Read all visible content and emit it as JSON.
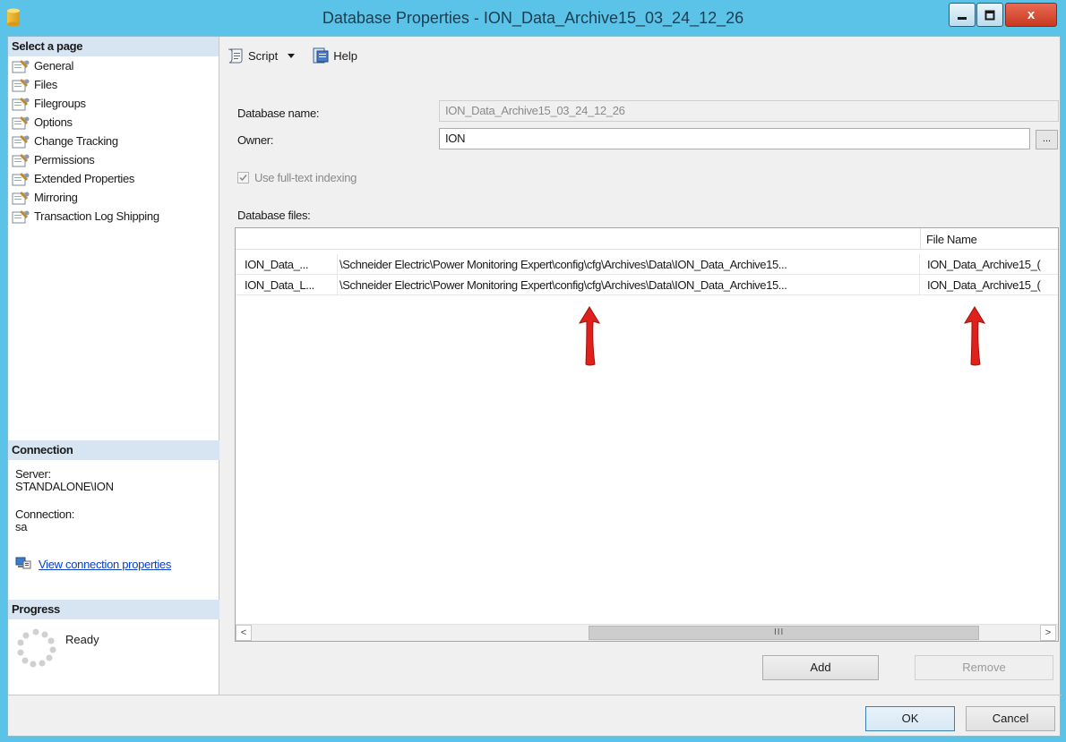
{
  "window": {
    "title": "Database Properties - ION_Data_Archive15_03_24_12_26",
    "close_glyph": "x"
  },
  "left_pane": {
    "select_page_header": "Select a page",
    "pages": [
      {
        "label": "General"
      },
      {
        "label": "Files"
      },
      {
        "label": "Filegroups"
      },
      {
        "label": "Options"
      },
      {
        "label": "Change Tracking"
      },
      {
        "label": "Permissions"
      },
      {
        "label": "Extended Properties"
      },
      {
        "label": "Mirroring"
      },
      {
        "label": "Transaction Log Shipping"
      }
    ],
    "connection_header": "Connection",
    "server_label": "Server:",
    "server_value": "STANDALONE\\ION",
    "connection_label": "Connection:",
    "connection_value": "sa",
    "view_connection_link": "View connection properties",
    "progress_header": "Progress",
    "progress_status": "Ready"
  },
  "toolbar": {
    "script_label": "Script",
    "help_label": "Help"
  },
  "form": {
    "database_name_label": "Database name:",
    "database_name_value": "ION_Data_Archive15_03_24_12_26",
    "owner_label": "Owner:",
    "owner_value": "ION",
    "browse_label": "...",
    "fulltext_label": "Use full-text indexing",
    "database_files_label": "Database files:"
  },
  "grid": {
    "columns": [
      "",
      "",
      "File Name"
    ],
    "rows": [
      {
        "logical_name": "ION_Data_...",
        "path": "\\Schneider Electric\\Power Monitoring Expert\\config\\cfg\\Archives\\Data\\ION_Data_Archive15...",
        "file_name": "ION_Data_Archive15_("
      },
      {
        "logical_name": "ION_Data_L...",
        "path": "\\Schneider Electric\\Power Monitoring Expert\\config\\cfg\\Archives\\Data\\ION_Data_Archive15...",
        "file_name": "ION_Data_Archive15_("
      }
    ],
    "scroll_left": "<",
    "scroll_right": ">",
    "scroll_thumb_grip": "III"
  },
  "buttons": {
    "add": "Add",
    "remove": "Remove",
    "ok": "OK",
    "cancel": "Cancel"
  },
  "colors": {
    "titlebar": "#5bc3e8",
    "section_header": "#d7e4f2",
    "link": "#0a3fc8",
    "annotation_arrow": "#e0201a"
  }
}
